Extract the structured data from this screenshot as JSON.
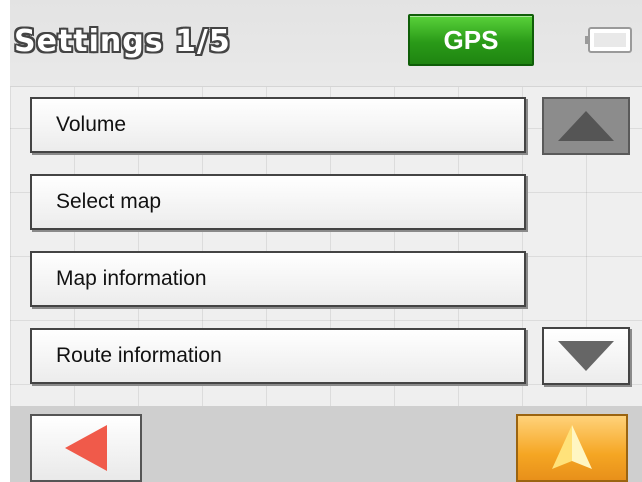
{
  "header": {
    "title": "Settings 1/5",
    "gps_label": "GPS",
    "gps_color": "#2a9a18"
  },
  "menu": {
    "items": [
      {
        "label": "Volume"
      },
      {
        "label": "Select map"
      },
      {
        "label": "Map information"
      },
      {
        "label": "Route information"
      }
    ]
  },
  "icons": {
    "battery": "battery-icon",
    "scroll_up": "triangle-up-icon",
    "scroll_down": "triangle-down-icon",
    "back": "triangle-left-icon",
    "navigate": "navigation-arrow-icon"
  },
  "colors": {
    "back_arrow": "#f05a4a",
    "navigate_button": "#f5a623",
    "scroll_arrow": "#555555"
  }
}
